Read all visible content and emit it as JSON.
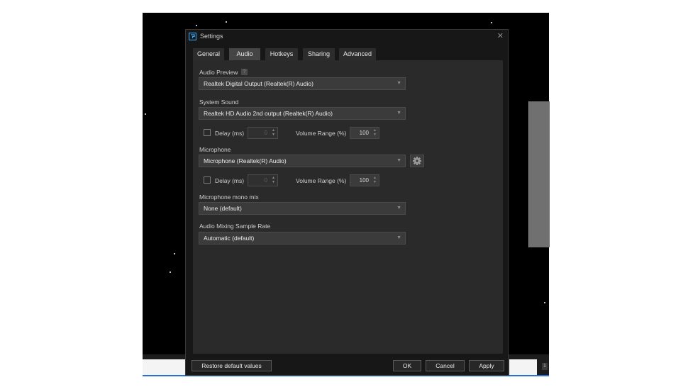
{
  "window": {
    "title": "Settings",
    "close_glyph": "✕",
    "app_icon": "settings-app-icon"
  },
  "tabs": [
    {
      "label": "General",
      "active": false
    },
    {
      "label": "Audio",
      "active": true
    },
    {
      "label": "Hotkeys",
      "active": false
    },
    {
      "label": "Sharing",
      "active": false
    },
    {
      "label": "Advanced",
      "active": false
    }
  ],
  "audio": {
    "preview": {
      "label": "Audio Preview",
      "help_glyph": "?",
      "value": "Realtek Digital Output (Realtek(R) Audio)"
    },
    "system_sound": {
      "label": "System Sound",
      "value": "Realtek HD Audio 2nd output (Realtek(R) Audio)",
      "delay_label": "Delay (ms)",
      "delay_checked": false,
      "delay_value": "0",
      "volume_label": "Volume Range (%)",
      "volume_value": "100"
    },
    "microphone": {
      "label": "Microphone",
      "value": "Microphone (Realtek(R) Audio)",
      "delay_label": "Delay (ms)",
      "delay_checked": false,
      "delay_value": "0",
      "volume_label": "Volume Range (%)",
      "volume_value": "100"
    },
    "mono_mix": {
      "label": "Microphone mono mix",
      "value": "None (default)"
    },
    "sample_rate": {
      "label": "Audio Mixing Sample Rate",
      "value": "Automatic (default)"
    }
  },
  "footer": {
    "restore_label": "Restore default values",
    "ok_label": "OK",
    "cancel_label": "Cancel",
    "apply_label": "Apply"
  },
  "taskbar": {
    "tray_glyph": "1"
  },
  "colors": {
    "dialog_bg": "#171717",
    "panel_bg": "#2a2a2a",
    "control_bg": "#3b3b3b",
    "active_tab": "#454545",
    "accent_icon": "#3aa0e8"
  }
}
